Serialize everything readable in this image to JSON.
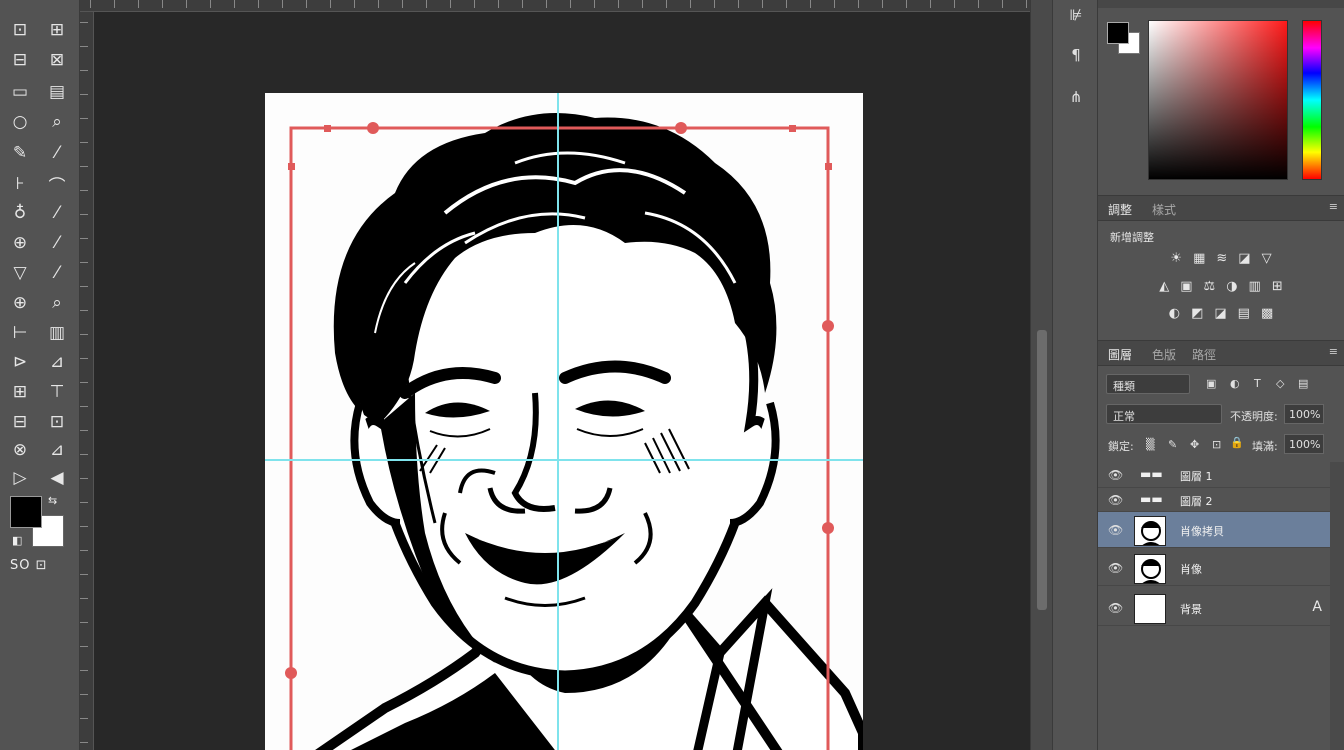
{
  "toolbox": {
    "tools": [
      [
        "⊡",
        "⊞"
      ],
      [
        "⊟",
        "⊠"
      ],
      [
        "▭",
        "▤"
      ],
      [
        "○",
        "⌕"
      ],
      [
        "✎",
        "⁄"
      ],
      [
        "⊦",
        "⌒"
      ],
      [
        "♁",
        "⁄"
      ],
      [
        "⊕",
        "⁄"
      ],
      [
        "▽",
        "⁄"
      ],
      [
        "⊕",
        "⌕"
      ],
      [
        "⊢",
        "▥"
      ],
      [
        "⊳",
        "⊿"
      ],
      [
        "⊞",
        "⊤"
      ],
      [
        "⊟",
        "⊡"
      ],
      [
        "⊗",
        "⊿"
      ],
      [
        "▷",
        "◀"
      ]
    ],
    "swap_icon": "⇆",
    "mini_swatch": "◧",
    "bottom_label": "SO ⊡"
  },
  "mid_column": {
    "buttons": [
      {
        "icon": "histogram-icon",
        "glyph": "⊯"
      },
      {
        "icon": "paragraph-icon",
        "glyph": "¶"
      },
      {
        "icon": "brush-settings-icon",
        "glyph": "⋔"
      }
    ]
  },
  "color_panel": {
    "foreground": "#000000",
    "background": "#ffffff"
  },
  "adjustments_panel": {
    "tabs": [
      "調整",
      "樣式"
    ],
    "menu_icon": "≡",
    "label": "新增調整",
    "rows": [
      [
        "☀",
        "▦",
        "≋",
        "◪",
        "▽"
      ],
      [
        "◭",
        "▣",
        "⚖",
        "◑",
        "▥",
        "⊞"
      ],
      [
        "◐",
        "◩",
        "◪",
        "▤",
        "▩"
      ]
    ]
  },
  "layers_panel": {
    "tabs": [
      "圖層",
      "色版",
      "路徑"
    ],
    "menu_icon": "≡",
    "kind_filter": "種類",
    "filter_icons": [
      "▣",
      "◐",
      "T",
      "◇",
      "▤"
    ],
    "blend_mode": "正常",
    "opacity_label": "不透明度:",
    "opacity_value": "100%",
    "lock_label": "鎖定:",
    "lock_icons": [
      "▒",
      "✎",
      "✥",
      "⊡",
      "🔒"
    ],
    "fill_label": "填滿:",
    "fill_value": "100%",
    "layers": [
      {
        "name": "圖層 1",
        "visible": true,
        "selected": false,
        "kind": "group"
      },
      {
        "name": "圖層 2",
        "visible": true,
        "selected": false,
        "kind": "group"
      },
      {
        "name": "肖像拷貝",
        "visible": true,
        "selected": true,
        "kind": "portrait"
      },
      {
        "name": "肖像",
        "visible": true,
        "selected": false,
        "kind": "portrait"
      },
      {
        "name": "背景",
        "visible": true,
        "selected": false,
        "kind": "background",
        "locked_icon": "A"
      }
    ]
  },
  "canvas": {
    "guide_color": "#7fe3ec",
    "selection_color": "#e05a5a"
  }
}
